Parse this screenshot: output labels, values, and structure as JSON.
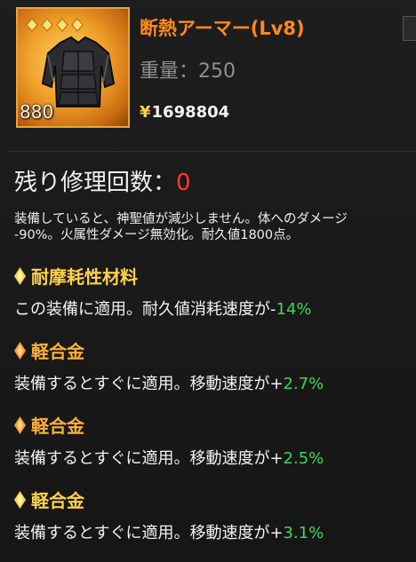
{
  "item": {
    "name": "断熱アーマー(Lv8)",
    "weight_label": "重量：",
    "weight_value": "250",
    "price_symbol": "¥",
    "price_value": "1698804",
    "level": "880",
    "icon": "armor-icon",
    "rarity_gems": 4
  },
  "repair": {
    "label": "残り修理回数：",
    "value": "0"
  },
  "description": {
    "line1": "装備していると、神聖値が減少しません。体へのダメージ",
    "line2": "-90%。火属性ダメージ無効化。耐久値1800点。"
  },
  "sections": [
    {
      "title": "耐摩耗性材料",
      "text": "この装備に適用。耐久値消耗速度が-",
      "value": "14%",
      "icon": "gold-diamond-icon"
    },
    {
      "title": "軽合金",
      "text": "装備するとすぐに適用。移動速度が+",
      "value": "2.7%",
      "icon": "orange-diamond-icon"
    },
    {
      "title": "軽合金",
      "text": "装備するとすぐに適用。移動速度が+",
      "value": "2.5%",
      "icon": "orange-diamond-icon"
    },
    {
      "title": "軽合金",
      "text": "装備するとすぐに適用。移動速度が+",
      "value": "3.1%",
      "icon": "gold-diamond-icon"
    }
  ],
  "colors": {
    "name": "#ff8a1a",
    "repair_value": "#ff3a2a",
    "positive_value": "#3fd65a",
    "title_orange": "#ffb03a",
    "title_gold": "#ffd24a"
  }
}
